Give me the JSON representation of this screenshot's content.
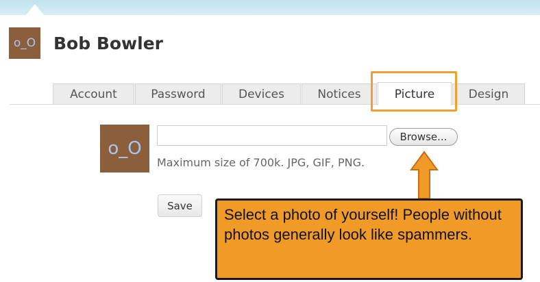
{
  "profile": {
    "avatar_text": "o_O",
    "name": "Bob Bowler"
  },
  "tabs": [
    {
      "label": "Account"
    },
    {
      "label": "Password"
    },
    {
      "label": "Devices"
    },
    {
      "label": "Notices"
    },
    {
      "label": "Picture",
      "active": true
    },
    {
      "label": "Design"
    }
  ],
  "upload": {
    "avatar_text": "o_O",
    "file_value": "",
    "browse_label": "Browse...",
    "hint": "Maximum size of 700k. JPG, GIF, PNG.",
    "save_label": "Save"
  },
  "callout": {
    "text": "Select a photo of yourself! People without photos generally look like spammers."
  },
  "colors": {
    "accent_orange": "#f09a28",
    "avatar_bg": "#8b5e3c",
    "avatar_text": "#a9c6f0",
    "top_band": "#bfe3ec"
  }
}
